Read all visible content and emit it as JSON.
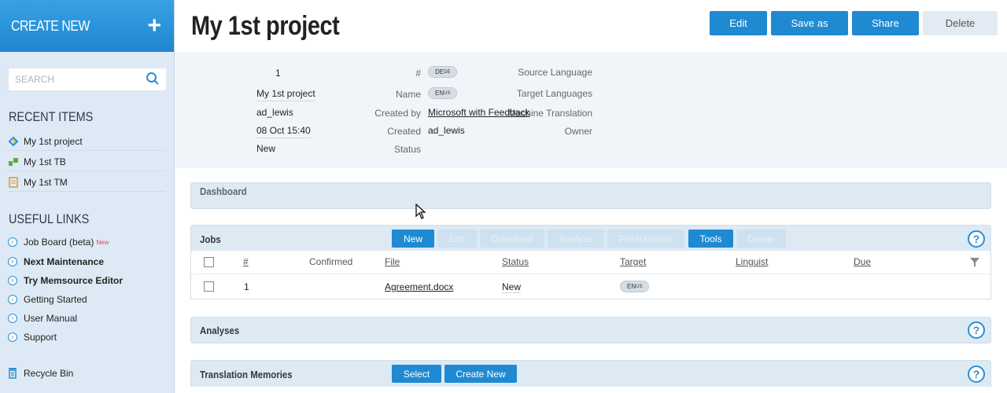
{
  "sidebar": {
    "create_new": "CREATE NEW",
    "search_placeholder": "SEARCH",
    "recent_heading": "RECENT ITEMS",
    "recent_items": [
      {
        "label": "My 1st project",
        "icon": "project-icon"
      },
      {
        "label": "My 1st TB",
        "icon": "termbase-icon"
      },
      {
        "label": "My 1st TM",
        "icon": "translation-memory-icon"
      }
    ],
    "links_heading": "USEFUL LINKS",
    "links": [
      {
        "label": "Job Board (beta)",
        "badge": "New"
      },
      {
        "label": "Next Maintenance"
      },
      {
        "label": "Try Memsource Editor"
      },
      {
        "label": "Getting Started"
      },
      {
        "label": "User Manual"
      },
      {
        "label": "Support"
      }
    ],
    "recycle_bin": "Recycle Bin"
  },
  "header": {
    "title": "My 1st project",
    "buttons": {
      "edit": "Edit",
      "save_as": "Save as",
      "share": "Share",
      "delete": "Delete"
    }
  },
  "project_info": {
    "number_label": "#",
    "number": "1",
    "name_label": "Name",
    "name": "My 1st project",
    "created_by_label": "Created by",
    "created_by": "ad_lewis",
    "created_label": "Created",
    "created": "08 Oct 15:40",
    "status_label": "Status",
    "status": "New",
    "source_lang_label": "Source Language",
    "source_lang": "DE",
    "source_lang_sup": "DE",
    "target_lang_label": "Target Languages",
    "target_lang": "EN",
    "target_lang_sup": "US",
    "mt_label": "Machine Translation",
    "mt": "Microsoft with Feedback",
    "owner_label": "Owner",
    "owner": "ad_lewis"
  },
  "dashboard": {
    "title": "Dashboard"
  },
  "jobs": {
    "title": "Jobs",
    "buttons": {
      "new": "New",
      "edit": "Edit",
      "download": "Download",
      "analyze": "Analyze",
      "pretranslate": "Pre-translate",
      "tools": "Tools",
      "delete": "Delete"
    },
    "columns": {
      "num": "#",
      "confirmed": "Confirmed",
      "file": "File",
      "status": "Status",
      "target": "Target",
      "linguist": "Linguist",
      "due": "Due"
    },
    "rows": [
      {
        "num": "1",
        "file": "Agreement.docx",
        "status": "New",
        "target": "EN",
        "target_sup": "US"
      }
    ]
  },
  "analyses": {
    "title": "Analyses"
  },
  "translation_memories": {
    "title": "Translation Memories",
    "buttons": {
      "select": "Select",
      "create_new": "Create New"
    }
  },
  "colors": {
    "accent": "#1f8ad2",
    "sidebar_bg": "#ddeaf5",
    "section_bg": "#dde9f3"
  }
}
